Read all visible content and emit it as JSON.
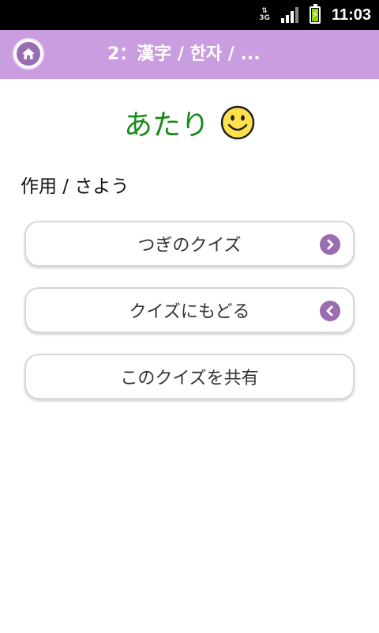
{
  "status_bar": {
    "network": "3G",
    "time": "11:03"
  },
  "app_bar": {
    "title": "2：漢字 / 한자 / ..."
  },
  "result": {
    "label": "あたり"
  },
  "answer": {
    "text": "作用 / さよう"
  },
  "buttons": {
    "next_quiz": "つぎのクイズ",
    "back_to_quiz": "クイズにもどる",
    "share_quiz": "このクイズを共有"
  },
  "colors": {
    "app_bar": "#c99ddf",
    "accent": "#9a6cb0",
    "result_text": "#1a8a1a"
  }
}
